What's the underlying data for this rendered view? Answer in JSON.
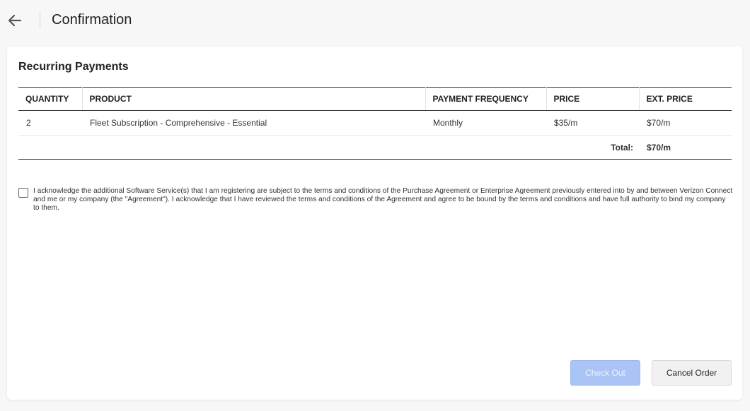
{
  "header": {
    "title": "Confirmation"
  },
  "section": {
    "title": "Recurring Payments"
  },
  "table": {
    "columns": [
      "QUANTITY",
      "PRODUCT",
      "PAYMENT FREQUENCY",
      "PRICE",
      "EXT. PRICE"
    ],
    "rows": [
      {
        "quantity": "2",
        "product": "Fleet Subscription - Comprehensive - Essential",
        "frequency": "Monthly",
        "price": "$35/m",
        "ext_price": "$70/m"
      }
    ],
    "total_label": "Total:",
    "total_value": "$70/m"
  },
  "acknowledgement": {
    "checked": false,
    "text": "I acknowledge the additional Software Service(s) that I am registering are subject to the terms and conditions of the Purchase Agreement or Enterprise Agreement previously entered into by and between Verizon Connect and me or my company (the \"Agreement\"). I acknowledge that I have reviewed the terms and conditions of the Agreement and agree to be bound by the terms and conditions and have full authority to bind my company to them."
  },
  "actions": {
    "checkout_label": "Check Out",
    "cancel_label": "Cancel Order"
  },
  "colors": {
    "checkout_bg": "#aac4f5",
    "page_bg": "#f7f7f7"
  },
  "icons": {
    "back": "arrow-left-icon"
  }
}
